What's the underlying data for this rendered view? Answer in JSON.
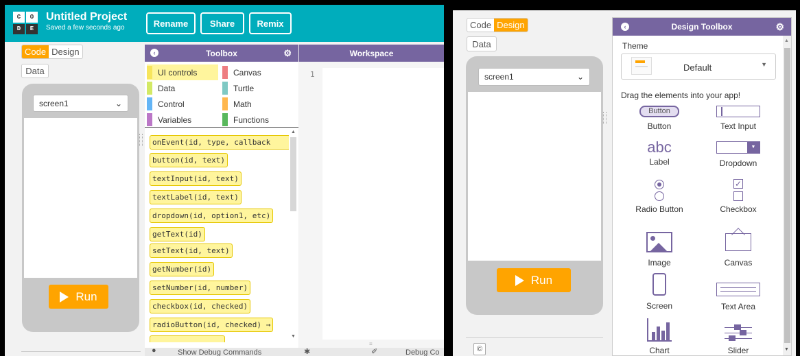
{
  "header": {
    "logo_letters": [
      "C",
      "O",
      "D",
      "E"
    ],
    "project_title": "Untitled Project",
    "saved_status": "Saved a few seconds ago",
    "buttons": {
      "rename": "Rename",
      "share": "Share",
      "remix": "Remix"
    },
    "brand_color": "#00adbc"
  },
  "left": {
    "mode_toggle": {
      "code": "Code",
      "design": "Design",
      "active": "Code"
    },
    "data_button": "Data",
    "screen_select": "screen1",
    "run_button": "Run",
    "toolbox": {
      "title": "Toolbox",
      "categories": [
        {
          "label": "UI controls",
          "color": "#f7e55c"
        },
        {
          "label": "Canvas",
          "color": "#ee7d81"
        },
        {
          "label": "Data",
          "color": "#d3e965"
        },
        {
          "label": "Turtle",
          "color": "#7fc9c4"
        },
        {
          "label": "Control",
          "color": "#64b5f6"
        },
        {
          "label": "Math",
          "color": "#ffb74d"
        },
        {
          "label": "Variables",
          "color": "#bb77c7"
        },
        {
          "label": "Functions",
          "color": "#59b85c"
        }
      ],
      "blocks": [
        "onEvent(id, type, callback",
        "button(id, text)",
        "textInput(id, text)",
        "textLabel(id, text)",
        "dropdown(id, option1, etc)",
        "getText(id)",
        "setText(id, text)",
        "getNumber(id)",
        "setNumber(id, number)",
        "checkbox(id, checked)",
        "radioButton(id, checked) →"
      ]
    },
    "workspace": {
      "title": "Workspace",
      "line_number": "1"
    },
    "bottom": {
      "debug_commands": "Show Debug Commands",
      "debug_console": "Debug Co"
    }
  },
  "right": {
    "mode_toggle": {
      "code": "Code",
      "design": "Design",
      "active": "Design"
    },
    "data_button": "Data",
    "screen_select": "screen1",
    "run_button": "Run",
    "copyright_icon_text": "©",
    "design_toolbox": {
      "title": "Design Toolbox",
      "theme_label": "Theme",
      "theme_value": "Default",
      "instructions": "Drag the elements into your app!",
      "items": [
        {
          "label": "Button",
          "icon": "button-icon",
          "icon_text": "Button"
        },
        {
          "label": "Text Input",
          "icon": "text-input-icon"
        },
        {
          "label": "Label",
          "icon": "label-icon",
          "icon_text": "abc"
        },
        {
          "label": "Dropdown",
          "icon": "dropdown-icon"
        },
        {
          "label": "Radio Button",
          "icon": "radio-button-icon"
        },
        {
          "label": "Checkbox",
          "icon": "checkbox-icon"
        },
        {
          "label": "Image",
          "icon": "image-icon"
        },
        {
          "label": "Canvas",
          "icon": "canvas-icon"
        },
        {
          "label": "Screen",
          "icon": "screen-icon"
        },
        {
          "label": "Text Area",
          "icon": "text-area-icon"
        },
        {
          "label": "Chart",
          "icon": "chart-icon"
        },
        {
          "label": "Slider",
          "icon": "slider-icon"
        }
      ]
    }
  },
  "colors": {
    "accent": "#ffa400",
    "toolbox_header": "#7665a0"
  }
}
